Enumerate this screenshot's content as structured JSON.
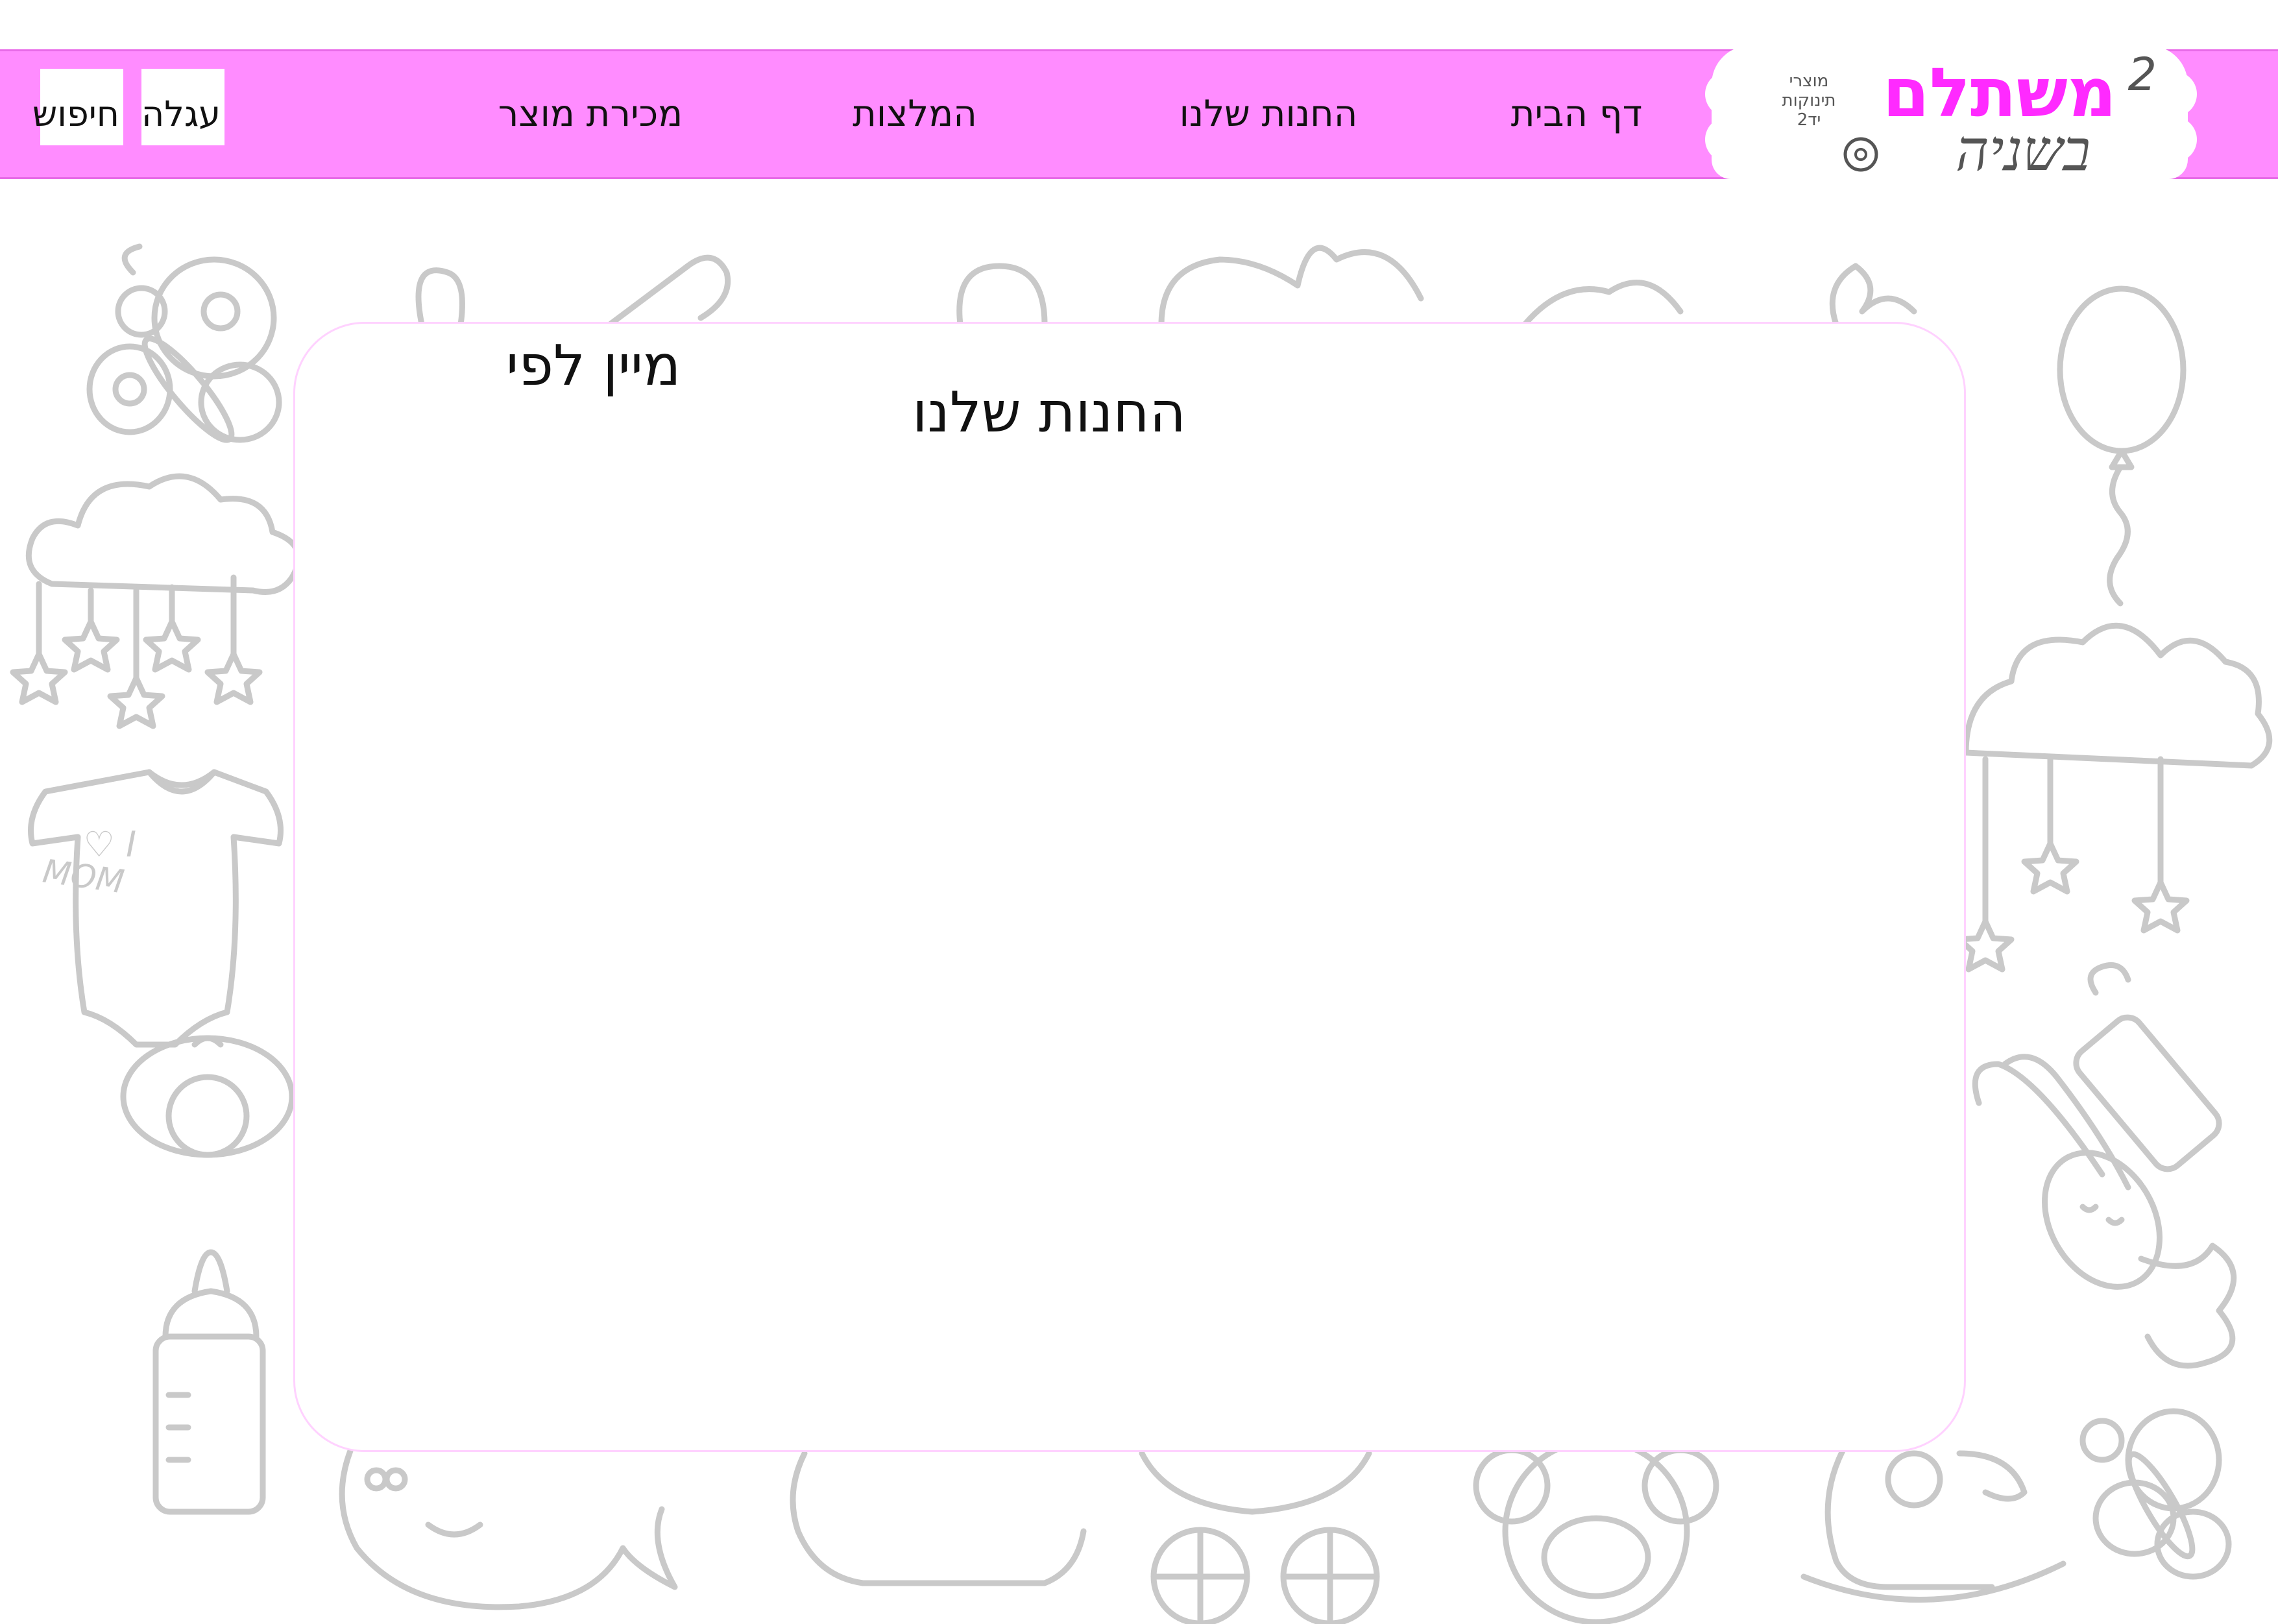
{
  "header": {
    "logo": {
      "brand": "משתלם",
      "sub": "בשניה",
      "superscript": "2",
      "small_lines": [
        "מוצרי",
        "תינוקות",
        "יד2"
      ]
    },
    "nav": [
      {
        "label": "דף הבית"
      },
      {
        "label": "החנות שלנו"
      },
      {
        "label": "המלצות"
      },
      {
        "label": "מכירת מוצר"
      }
    ],
    "cart_label": "עגלה",
    "search_label": "חיפוש"
  },
  "main": {
    "sort_label": "מיין לפי",
    "title": "החנות שלנו"
  },
  "background": {
    "onesie_text": [
      "I ♡",
      "MOM"
    ]
  },
  "colors": {
    "header_bg": "#ff8cff",
    "logo_accent": "#ff2aff",
    "doodle": "#c9c9c9",
    "card_border": "#ffd2ff"
  }
}
